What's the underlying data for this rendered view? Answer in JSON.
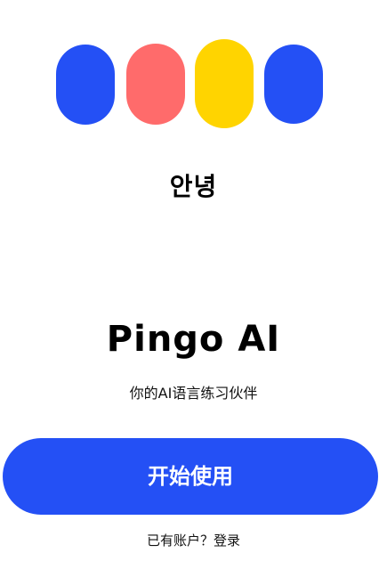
{
  "logo": {
    "pills": [
      "#2450F5",
      "#FF6B6B",
      "#FFD400",
      "#2450F5"
    ]
  },
  "greeting": "안녕",
  "app_name": "Pingo AI",
  "tagline": "你的AI语言练习伙伴",
  "start_button": {
    "label": "开始使用",
    "color": "#2450F5"
  },
  "login": {
    "prompt": "已有账户？",
    "link": "登录"
  }
}
